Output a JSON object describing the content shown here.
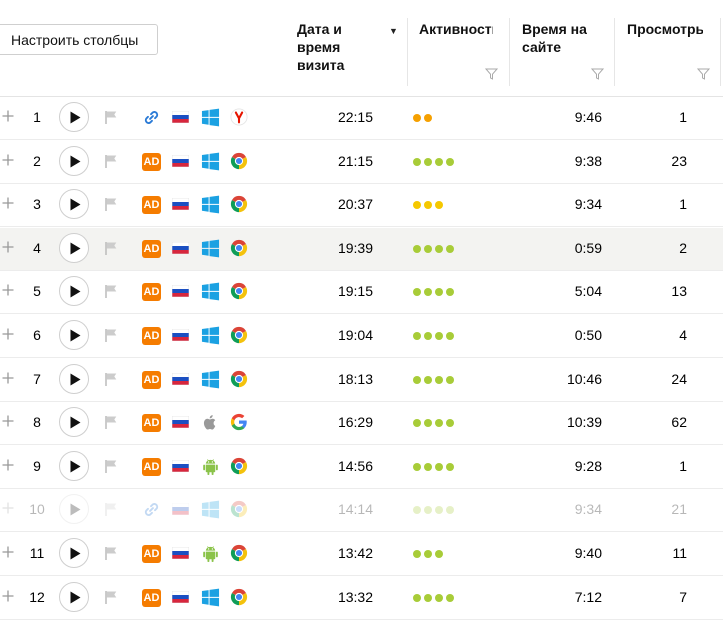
{
  "toolbar": {
    "configure_columns": "Настроить столбцы"
  },
  "columns": {
    "datetime": "Дата и\nвремя\nвизита",
    "activity": "Активность",
    "time_on_site": "Время на\nсайте",
    "views": "Просмотры"
  },
  "colors": {
    "ad_badge": "#f57c00",
    "activity_green": "#a8cc38",
    "activity_orange": "#f5a000",
    "activity_yellow": "#f5c800"
  },
  "rows": [
    {
      "num": "1",
      "source": "link-icon",
      "os": "windows-icon",
      "browser": "yandex-browser-icon",
      "time": "22:15",
      "activity": 2,
      "activity_color": "orange",
      "duration": "9:46",
      "views": "1"
    },
    {
      "num": "2",
      "source": "ad-badge",
      "source_label": "AD",
      "os": "windows-icon",
      "browser": "chrome-icon",
      "time": "21:15",
      "activity": 4,
      "activity_color": "green",
      "duration": "9:38",
      "views": "23"
    },
    {
      "num": "3",
      "source": "ad-badge",
      "source_label": "AD",
      "os": "windows-icon",
      "browser": "chrome-icon",
      "time": "20:37",
      "activity": 3,
      "activity_color": "yellow",
      "duration": "9:34",
      "views": "1"
    },
    {
      "num": "4",
      "source": "ad-badge",
      "source_label": "AD",
      "os": "windows-icon",
      "browser": "chrome-icon",
      "time": "19:39",
      "activity": 4,
      "activity_color": "green",
      "duration": "0:59",
      "views": "2"
    },
    {
      "num": "5",
      "source": "ad-badge",
      "source_label": "AD",
      "os": "windows-icon",
      "browser": "chrome-icon",
      "time": "19:15",
      "activity": 4,
      "activity_color": "green",
      "duration": "5:04",
      "views": "13"
    },
    {
      "num": "6",
      "source": "ad-badge",
      "source_label": "AD",
      "os": "windows-icon",
      "browser": "chrome-icon",
      "time": "19:04",
      "activity": 4,
      "activity_color": "green",
      "duration": "0:50",
      "views": "4"
    },
    {
      "num": "7",
      "source": "ad-badge",
      "source_label": "AD",
      "os": "windows-icon",
      "browser": "chrome-icon",
      "time": "18:13",
      "activity": 4,
      "activity_color": "green",
      "duration": "10:46",
      "views": "24"
    },
    {
      "num": "8",
      "source": "ad-badge",
      "source_label": "AD",
      "os": "apple-icon",
      "browser": "google-icon",
      "time": "16:29",
      "activity": 4,
      "activity_color": "green",
      "duration": "10:39",
      "views": "62"
    },
    {
      "num": "9",
      "source": "ad-badge",
      "source_label": "AD",
      "os": "android-icon",
      "browser": "chrome-icon",
      "time": "14:56",
      "activity": 4,
      "activity_color": "green",
      "duration": "9:28",
      "views": "1"
    },
    {
      "num": "10",
      "source": "link-icon",
      "os": "windows-icon",
      "browser": "chrome-icon",
      "time": "14:14",
      "activity": 4,
      "activity_color": "green",
      "duration": "9:34",
      "views": "21",
      "faded": true
    },
    {
      "num": "11",
      "source": "ad-badge",
      "source_label": "AD",
      "os": "android-icon",
      "browser": "chrome-icon",
      "time": "13:42",
      "activity": 3,
      "activity_color": "green",
      "duration": "9:40",
      "views": "11"
    },
    {
      "num": "12",
      "source": "ad-badge",
      "source_label": "AD",
      "os": "windows-icon",
      "browser": "chrome-icon",
      "time": "13:32",
      "activity": 4,
      "activity_color": "green",
      "duration": "7:12",
      "views": "7"
    }
  ]
}
